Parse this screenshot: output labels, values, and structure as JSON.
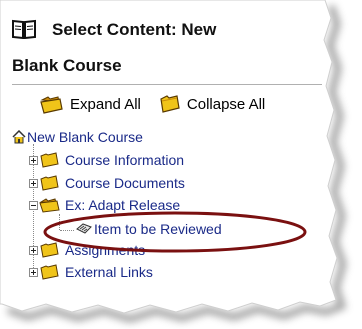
{
  "header": {
    "title_line1": "Select Content: New",
    "title_line2": "Blank Course"
  },
  "toolbar": {
    "expand_label": "Expand All",
    "collapse_label": "Collapse All"
  },
  "tree": {
    "root": {
      "label": "New Blank Course"
    },
    "items": [
      {
        "label": "Course Information",
        "expander": "plus"
      },
      {
        "label": "Course Documents",
        "expander": "plus"
      },
      {
        "label": "Ex: Adapt Release",
        "expander": "minus"
      },
      {
        "label": "Item to be Reviewed"
      },
      {
        "label": "Assignments",
        "expander": "plus"
      },
      {
        "label": "External Links",
        "expander": "plus"
      }
    ]
  },
  "colors": {
    "tree_link": "#1a2a88",
    "highlight_ellipse": "#7a1010",
    "folder_yellow": "#f0c419"
  }
}
